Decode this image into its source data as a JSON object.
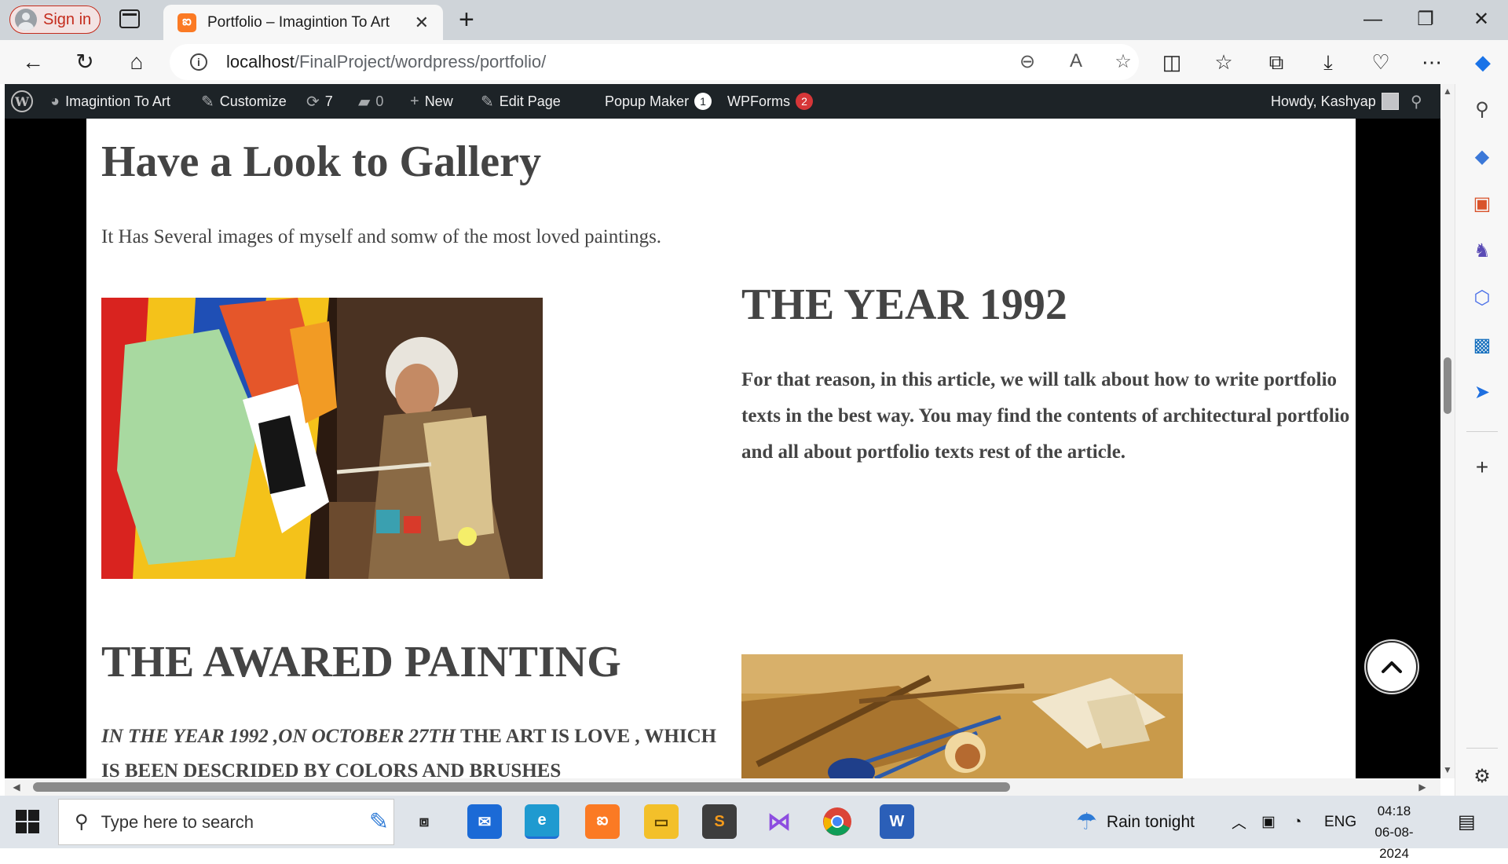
{
  "browser": {
    "sign_in_label": "Sign in",
    "tab_title": "Portfolio – Imagintion To Art",
    "url_host": "localhost",
    "url_path": "/FinalProject/wordpress/portfolio/"
  },
  "wp_admin_bar": {
    "site_name": "Imagintion To Art",
    "customize": "Customize",
    "updates_count": "7",
    "comments_count": "0",
    "new_label": "New",
    "edit_page": "Edit Page",
    "popup_maker": "Popup Maker",
    "popup_maker_badge": "1",
    "wpforms": "WPForms",
    "wpforms_badge": "2",
    "howdy": "Howdy, Kashyap"
  },
  "page": {
    "gallery_heading": "Have a Look to Gallery",
    "gallery_description": "It Has Several images of myself and somw of the most loved paintings.",
    "year_heading": "THE YEAR 1992",
    "year_paragraph": "For that reason, in this article, we will talk about how to write portfolio texts in the best way. You may find the contents of architectural portfolio and all about portfolio texts rest of the article.",
    "award_heading": "THE AWARED PAINTING",
    "award_italic": "IN THE YEAR 1992 ,ON OCTOBER 27TH",
    "award_rest": " THE ART IS LOVE , WHICH IS BEEN DESCRIDED BY COLORS AND BRUSHES"
  },
  "taskbar": {
    "search_placeholder": "Type here to search",
    "weather": "Rain tonight",
    "language": "ENG",
    "time": "04:18",
    "date": "06-08-2024"
  },
  "colors": {
    "wp_admin_bg": "#1d2327",
    "heading_text": "#444444",
    "badge_red": "#d63638",
    "edge_tabstrip": "#cfd4d9"
  }
}
